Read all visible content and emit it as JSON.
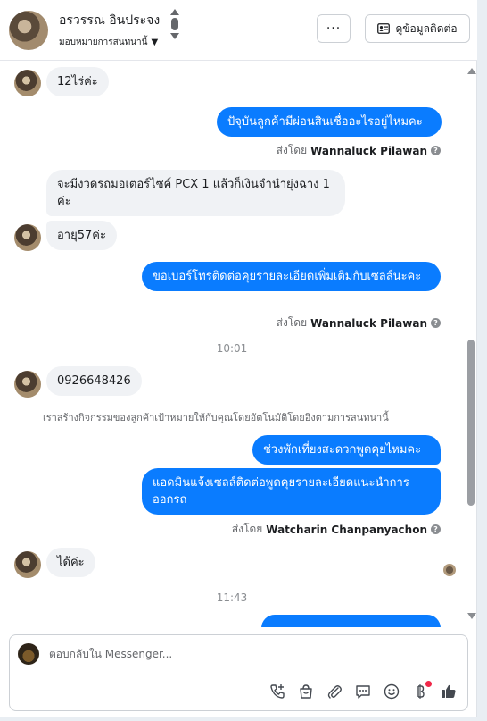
{
  "header": {
    "contact_name": "อรวรรณ อินประจง",
    "assign_label": "มอบหมายการสนทนานี้",
    "more_label": "···",
    "contact_info_label": "ดูข้อมูลติดต่อ"
  },
  "messages": {
    "m1_text": "12ไร่ค่ะ",
    "m2_text": "ปัจุบันลูกค้ามีผ่อนสินเชื่ออะไรอยู่ไหมคะ",
    "m2_sent_prefix": "ส่งโดย",
    "m2_agent": "Wannaluck Pilawan",
    "m3_text": "จะมีงวดรถมอเตอร์ไซค์ PCX 1 แล้วก็เงินจำนำยุ่งฉาง 1 ค่ะ",
    "m4_text": "อายุ57ค่ะ",
    "m5_text": "ขอเบอร์โทรติดต่อคุยรายละเอียดเพิ่มเติมกับเซลล์นะคะ",
    "m5_sent_prefix": "ส่งโดย",
    "m5_agent": "Wannaluck Pilawan",
    "time1": "10:01",
    "m6_text": "0926648426",
    "system_note": "เราสร้างกิจกรรมของลูกค้าเป้าหมายให้กับคุณโดยอัตโนมัติโดยอิงตามการสนทนานี้",
    "m7_text": "ช่วงพักเที่ยงสะดวกพูดคุยไหมคะ",
    "m8_text": "แอดมินแจ้งเซลล์ติดต่อพูดคุยรายละเอียดแนะนำการออกรถ",
    "m8_sent_prefix": "ส่งโดย",
    "m8_agent": "Watcharin Chanpanyachon",
    "m9_text": "ได้ค่ะ",
    "time2": "11:43"
  },
  "composer": {
    "placeholder": "ตอบกลับใน Messenger..."
  },
  "colors": {
    "outgoing_bubble": "#0a7cff",
    "incoming_bubble": "#f0f2f5",
    "notification_dot": "#f02849"
  }
}
